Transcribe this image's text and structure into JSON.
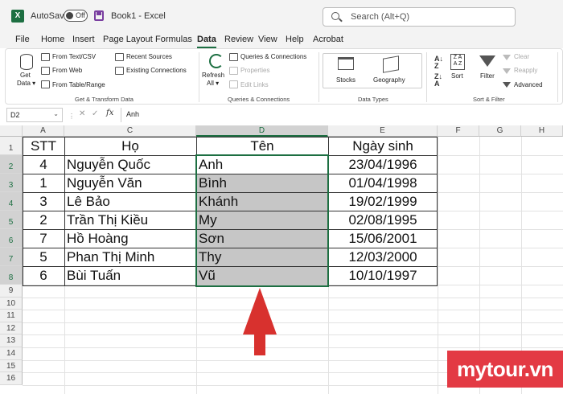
{
  "titlebar": {
    "autosave_label": "AutoSave",
    "autosave_state": "Off",
    "document_title": "Book1  -  Excel",
    "search_placeholder": "Search (Alt+Q)"
  },
  "menu": {
    "tabs": [
      "File",
      "Home",
      "Insert",
      "Page Layout",
      "Formulas",
      "Data",
      "Review",
      "View",
      "Help",
      "Acrobat"
    ],
    "active": "Data"
  },
  "ribbon": {
    "get_data": "Get",
    "get_data_2": "Data ▾",
    "from_text_csv": "From Text/CSV",
    "from_web": "From Web",
    "from_table_range": "From Table/Range",
    "recent_sources": "Recent Sources",
    "existing_connections": "Existing Connections",
    "group_get_transform": "Get & Transform Data",
    "refresh": "Refresh",
    "refresh_all": "All ▾",
    "queries_connections": "Queries & Connections",
    "properties": "Properties",
    "edit_links": "Edit Links",
    "group_queries": "Queries & Connections",
    "stocks": "Stocks",
    "geography": "Geography",
    "group_data_types": "Data Types",
    "sort": "Sort",
    "filter": "Filter",
    "clear": "Clear",
    "reapply": "Reapply",
    "advanced": "Advanced",
    "group_sort_filter": "Sort & Filter"
  },
  "formula_bar": {
    "name_box": "D2",
    "fx": "fx",
    "content": "Anh"
  },
  "sheet": {
    "columns": [
      "A",
      "C",
      "D",
      "E",
      "F",
      "G",
      "H"
    ],
    "rows": [
      "1",
      "2",
      "3",
      "4",
      "5",
      "6",
      "7",
      "8",
      "9",
      "10",
      "11",
      "12",
      "13",
      "14",
      "15",
      "16"
    ],
    "header": [
      "STT",
      "Họ",
      "Tên",
      "Ngày sinh"
    ],
    "data": [
      [
        "4",
        "Nguyễn Quốc",
        "Anh",
        "23/04/1996"
      ],
      [
        "1",
        "Nguyễn Văn",
        "Bình",
        "01/04/1998"
      ],
      [
        "3",
        "Lê Bảo",
        "Khánh",
        "19/02/1999"
      ],
      [
        "2",
        "Trần Thị Kiều",
        "My",
        "02/08/1995"
      ],
      [
        "7",
        "Hồ Hoàng",
        "Sơn",
        "15/06/2001"
      ],
      [
        "5",
        "Phan Thị Minh",
        "Thy",
        "12/03/2000"
      ],
      [
        "6",
        "Bùi Tuấn",
        "Vũ",
        "10/10/1997"
      ]
    ],
    "selected_column": "D",
    "selected_range": "D2:D8"
  },
  "colors": {
    "accent": "#1d6f42",
    "arrow": "#d8312e",
    "selection_fill": "#c6c6c6",
    "watermark_bg": "#e33a44"
  },
  "watermark": "mytour.vn"
}
